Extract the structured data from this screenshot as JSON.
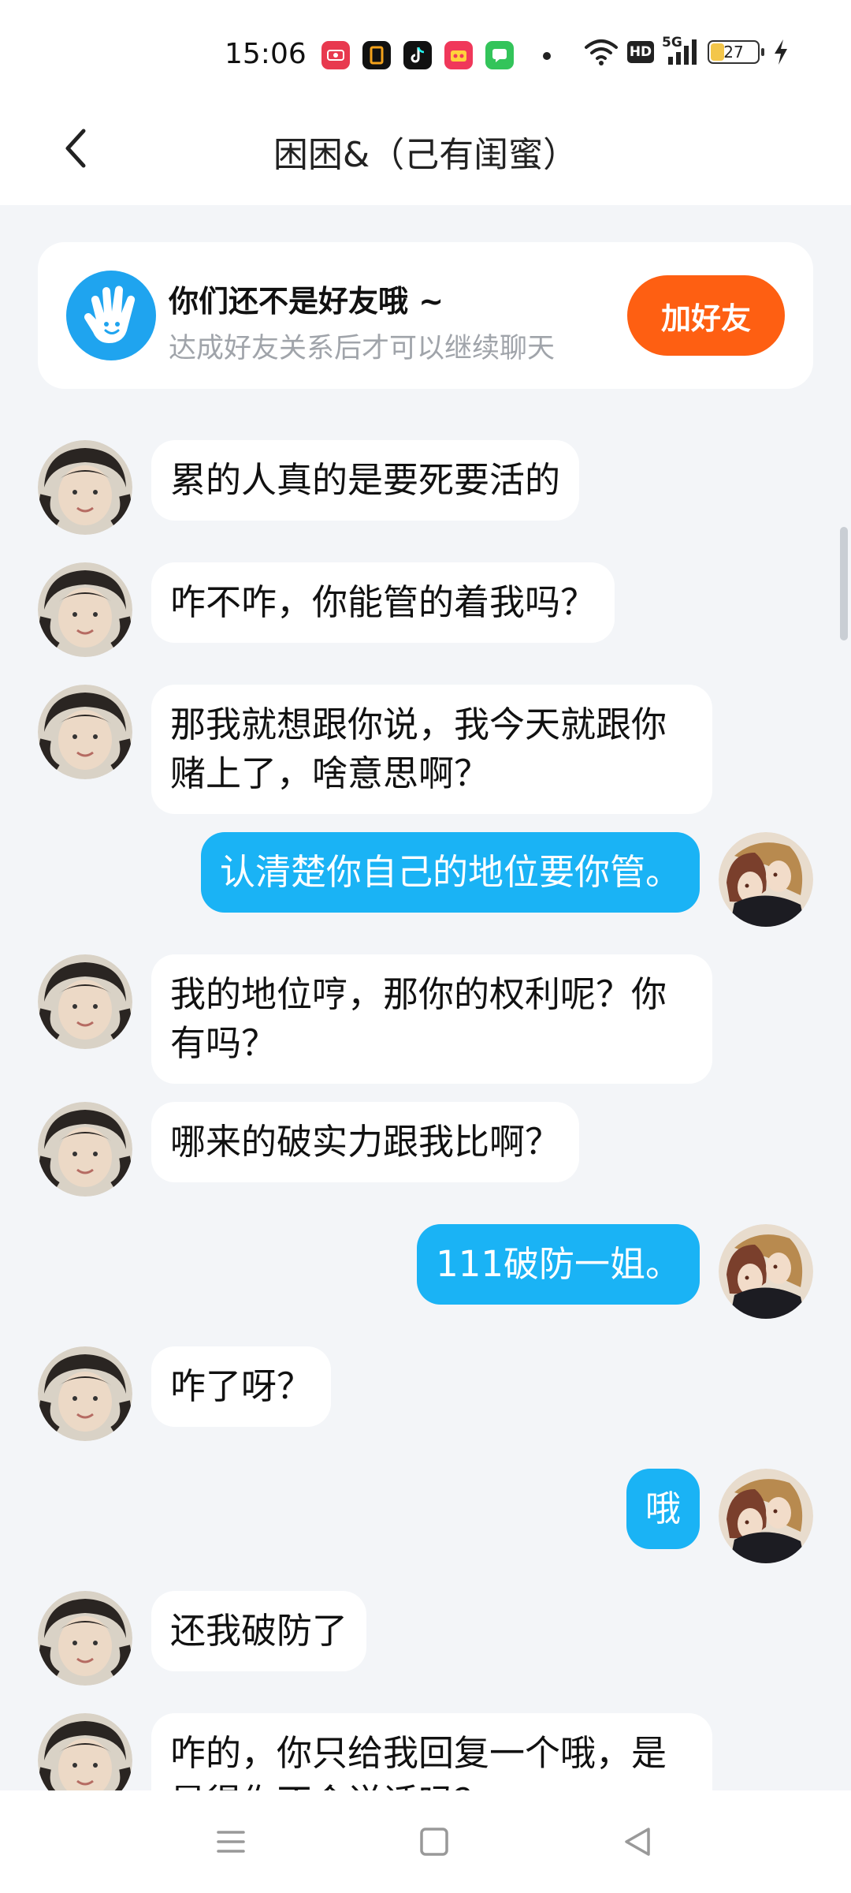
{
  "status_bar": {
    "time": "15:06",
    "battery": "27",
    "network": "5G"
  },
  "header": {
    "title": "困困&（己有闺蜜）"
  },
  "friend_notice": {
    "title": "你们还不是好友哦 ~",
    "subtitle": "达成好友关系后才可以继续聊天",
    "button": "加好友"
  },
  "messages": [
    {
      "side": "in",
      "text": "累的人真的是要死要活的"
    },
    {
      "side": "in",
      "text": "咋不咋，你能管的着我吗？"
    },
    {
      "side": "in",
      "text": "那我就想跟你说，我今天就跟你赌上了，啥意思啊？"
    },
    {
      "side": "out",
      "text": "认清楚你自己的地位要你管。"
    },
    {
      "side": "in",
      "text": "我的地位哼，那你的权利呢？你有吗？"
    },
    {
      "side": "in",
      "text": "哪来的破实力跟我比啊？"
    },
    {
      "side": "out",
      "text": "111破防一姐。"
    },
    {
      "side": "in",
      "text": "咋了呀？"
    },
    {
      "side": "out",
      "text": "哦"
    },
    {
      "side": "in",
      "text": "还我破防了"
    },
    {
      "side": "in",
      "text": "咋的，你只给我回复一个哦，是是得你不会说话吗？"
    }
  ],
  "colors": {
    "accent_blue": "#1ab3f5",
    "add_button": "#fe5f12",
    "background": "#f3f5f8"
  }
}
